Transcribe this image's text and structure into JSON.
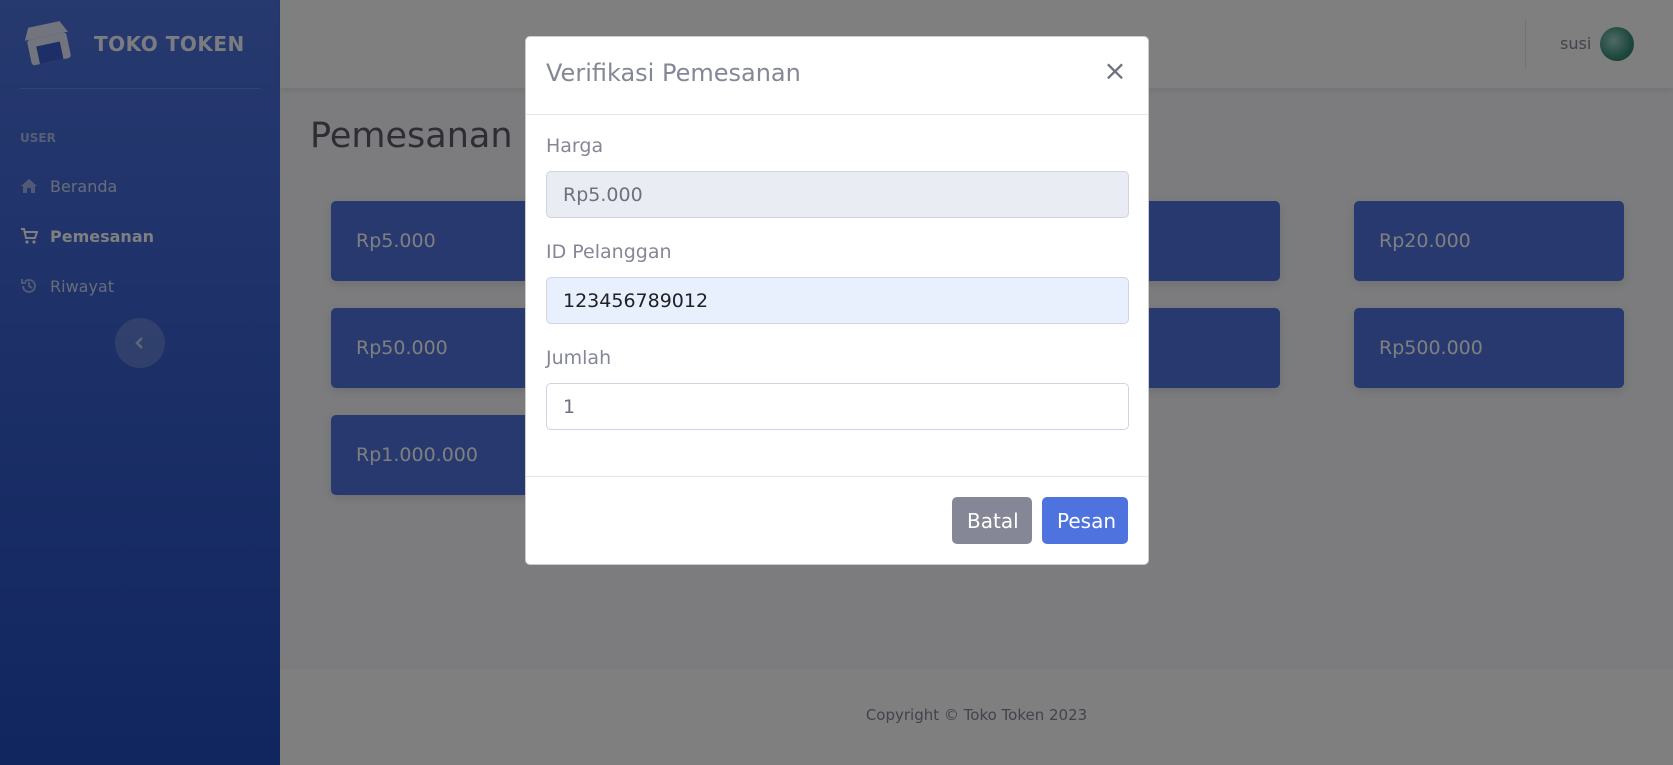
{
  "brand": {
    "name": "TOKO TOKEN"
  },
  "sidebar": {
    "heading": "USER",
    "items": [
      {
        "label": "Beranda",
        "icon": "home-icon",
        "active": false
      },
      {
        "label": "Pemesanan",
        "icon": "cart-icon",
        "active": true
      },
      {
        "label": "Riwayat",
        "icon": "history-icon",
        "active": false
      }
    ],
    "toggle_icon": "chevron-left-icon"
  },
  "topbar": {
    "username": "susi"
  },
  "main": {
    "title": "Pemesanan",
    "tokens": [
      "Rp5.000",
      "Rp20.000",
      "Rp50.000",
      "Rp500.000",
      "Rp1.000.000"
    ]
  },
  "footer": {
    "text": "Copyright © Toko Token 2023"
  },
  "modal": {
    "title": "Verifikasi Pemesanan",
    "close_label": "×",
    "fields": {
      "harga": {
        "label": "Harga",
        "value": "Rp5.000"
      },
      "id_pelanggan": {
        "label": "ID Pelanggan",
        "value": "123456789012"
      },
      "jumlah": {
        "label": "Jumlah",
        "value": "1"
      }
    },
    "cancel_label": "Batal",
    "submit_label": "Pesan"
  },
  "colors": {
    "primary": "#4e73df",
    "secondary": "#858796",
    "sidebar_dark": "#224abe"
  }
}
